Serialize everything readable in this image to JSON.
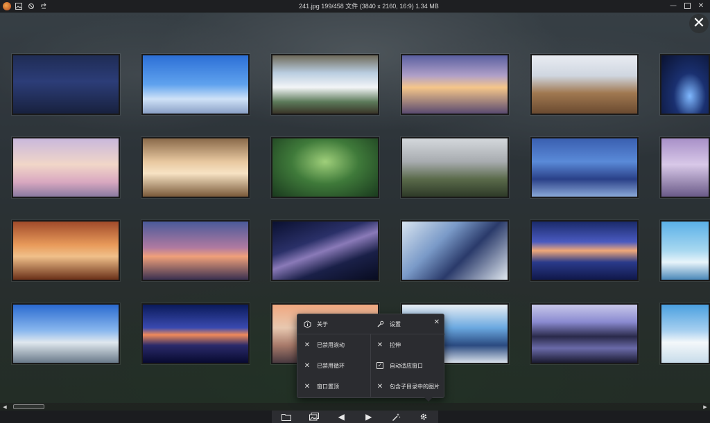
{
  "window": {
    "title": "241.jpg 199/458 文件 (3840 x 2160, 16:9) 1.34 MB"
  },
  "titlebar": {
    "icons": [
      "app-icon",
      "image-icon",
      "refresh-icon",
      "flip-icon"
    ],
    "controls": [
      "minimize-icon",
      "maximize-icon",
      "close-icon"
    ]
  },
  "thumbnails": {
    "rows": 4,
    "cols": 6,
    "scenes": [
      [
        "night-bedroom",
        "sky-ruins",
        "girl-window",
        "classroom-sunset",
        "classroom-day",
        "night-sky"
      ],
      [
        "pastel-room",
        "japanese-room",
        "forest",
        "hill-city",
        "night-street",
        "purple-room"
      ],
      [
        "warm-room",
        "sunset-clouds",
        "galaxy",
        "anime-city",
        "reflection-sunset",
        "ocean-day"
      ],
      [
        "rooftop-day",
        "rice-field-sunset",
        "street-sunset",
        "room-blue",
        "mountain-lake",
        "clouds-sky"
      ]
    ]
  },
  "popup": {
    "about": "关于",
    "settings": "设置",
    "items": [
      {
        "label": "已禁用滚动",
        "checked": false
      },
      {
        "label": "拉伸",
        "checked": false
      },
      {
        "label": "已禁用循环",
        "checked": false
      },
      {
        "label": "自动适应窗口",
        "checked": true
      },
      {
        "label": "窗口置顶",
        "checked": false
      },
      {
        "label": "包含子目录中的图片",
        "checked": false
      }
    ]
  },
  "bottombar": {
    "buttons": [
      "folder-icon",
      "gallery-icon",
      "prev-icon",
      "next-icon",
      "magic-wand-icon",
      "gear-icon"
    ]
  },
  "colors": {
    "titlebar": "#1e1f22",
    "popup_bg": "#2b2c30",
    "toolbar_bg": "#2c2d31"
  }
}
